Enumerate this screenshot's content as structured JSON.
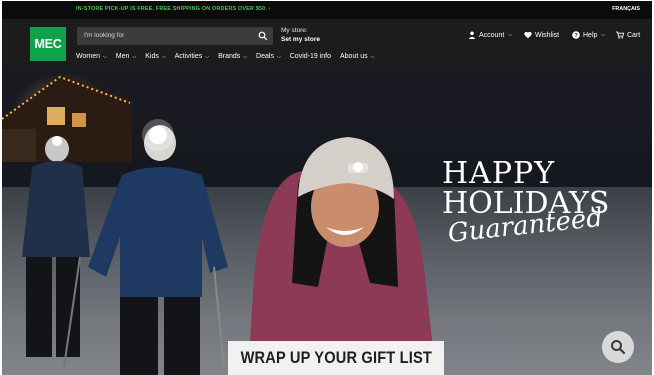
{
  "promo": {
    "message": "IN-STORE PICK-UP IS FREE. FREE SHIPPING ON ORDERS OVER $50.  ›",
    "language": "FRANÇAIS"
  },
  "header": {
    "logo": "MEC",
    "search_placeholder": "I'm looking for",
    "store_label": "My store:",
    "store_link": "Set my store",
    "account": "Account",
    "wishlist": "Wishlist",
    "help": "Help",
    "cart": "Cart"
  },
  "nav": [
    "Women",
    "Men",
    "Kids",
    "Activities",
    "Brands",
    "Deals",
    "Covid-19 info",
    "About us"
  ],
  "hero": {
    "line1": "HAPPY",
    "line2": "HOLIDAYS",
    "line3": "Guaranteed",
    "banner": "WRAP UP YOUR GIFT LIST"
  },
  "colors": {
    "brand_green": "#0ea34a",
    "promo_green": "#53c15a",
    "header_bg": "#1c1c1c"
  }
}
